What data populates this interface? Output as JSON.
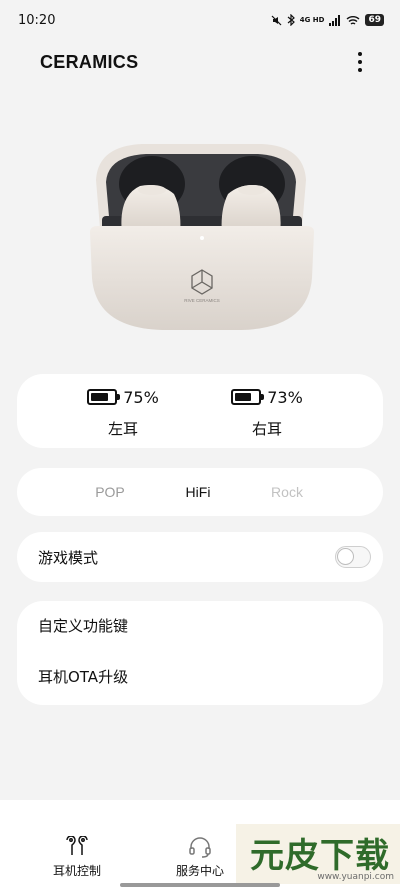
{
  "status_bar": {
    "time": "10:20",
    "network": "4G HD",
    "battery": "69",
    "icons": [
      "mute-icon",
      "bluetooth-icon",
      "signal-icon",
      "wifi-icon",
      "battery-icon"
    ]
  },
  "header": {
    "title": "CERAMICS",
    "menu_icon": "more-vertical-icon"
  },
  "product": {
    "logo_caption": "RIVE CERAMICS"
  },
  "battery": {
    "left": {
      "label": "左耳",
      "percent_text": "75%",
      "level": 0.75
    },
    "right": {
      "label": "右耳",
      "percent_text": "73%",
      "level": 0.73
    }
  },
  "eq": {
    "modes": [
      "POP",
      "HiFi",
      "Rock"
    ],
    "selected": "HiFi"
  },
  "game_mode": {
    "label": "游戏模式",
    "enabled": false
  },
  "settings": {
    "items": [
      "自定义功能键",
      "耳机OTA升级"
    ]
  },
  "bottom_nav": {
    "items": [
      {
        "label": "耳机控制",
        "icon": "earbuds-icon"
      },
      {
        "label": "服务中心",
        "icon": "headset-support-icon"
      }
    ]
  },
  "watermark": {
    "text": "元皮下载",
    "url": "www.yuanpi.com"
  },
  "colors": {
    "background": "#f3f3f3",
    "card": "#ffffff",
    "watermark_green": "#2f6b2a"
  }
}
